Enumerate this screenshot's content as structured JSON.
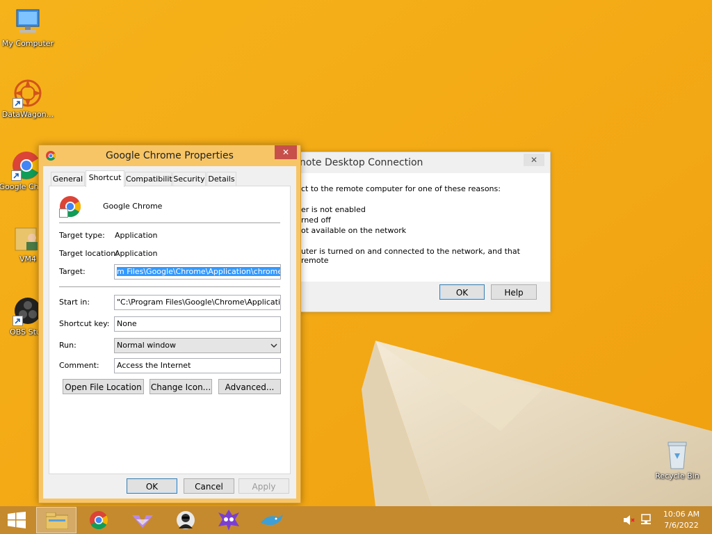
{
  "desktop": {
    "icons": [
      {
        "label": "My Computer"
      },
      {
        "label": "DataWagon..."
      },
      {
        "label": "Google Chrom"
      },
      {
        "label": "VM4"
      },
      {
        "label": "OBS Stud"
      },
      {
        "label": "Recycle Bin"
      }
    ]
  },
  "rdc_dialog": {
    "title": "Remote Desktop Connection",
    "title_visible": "note Desktop Connection",
    "lines": [
      "ct to the remote computer for one of these reasons:",
      "er is not enabled",
      "rned off",
      "ot available on the network",
      "uter is turned on and connected to the network, and that remote"
    ],
    "ok_label": "OK",
    "help_label": "Help",
    "close_glyph": "✕"
  },
  "properties": {
    "title": "Google Chrome Properties",
    "close_glyph": "✕",
    "tabs": [
      {
        "label": "General"
      },
      {
        "label": "Shortcut"
      },
      {
        "label": "Compatibility"
      },
      {
        "label": "Security"
      },
      {
        "label": "Details"
      }
    ],
    "app_name": "Google Chrome",
    "target_type_label": "Target type:",
    "target_type_value": "Application",
    "target_location_label": "Target location:",
    "target_location_value": "Application",
    "target_label": "Target:",
    "target_value": "m Files\\Google\\Chrome\\Application\\chrome.exe\"",
    "start_in_label": "Start in:",
    "start_in_value": "\"C:\\Program Files\\Google\\Chrome\\Application\"",
    "shortcut_key_label": "Shortcut key:",
    "shortcut_key_value": "None",
    "run_label": "Run:",
    "run_value": "Normal window",
    "comment_label": "Comment:",
    "comment_value": "Access the Internet",
    "open_file_location_label": "Open File Location",
    "change_icon_label": "Change Icon...",
    "advanced_label": "Advanced...",
    "ok_label": "OK",
    "cancel_label": "Cancel",
    "apply_label": "Apply"
  },
  "taskbar": {
    "items": [
      {
        "name": "file-explorer"
      },
      {
        "name": "chrome"
      },
      {
        "name": "app-3"
      },
      {
        "name": "app-4"
      },
      {
        "name": "app-5"
      },
      {
        "name": "app-6"
      }
    ],
    "time": "10:06 AM",
    "date": "7/6/2022"
  },
  "colors": {
    "wallpaper": "#f4a712",
    "taskbar": "#c58a2d",
    "window_frame": "#f7c566",
    "close_button": "#c7504a",
    "selection": "#3399ff"
  }
}
